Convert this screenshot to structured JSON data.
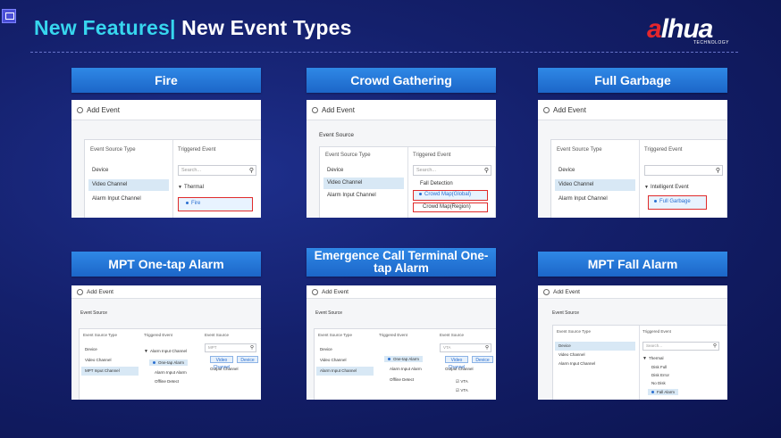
{
  "header": {
    "title_accent": "New Features|",
    "title_rest": " New Event Types",
    "logo_text_a": "a",
    "logo_text_rest": "lhua",
    "logo_sub": "TECHNOLOGY"
  },
  "cards": [
    {
      "title": "Fire",
      "window_title": "Add Event",
      "col1": "Event Source Type",
      "col2": "Triggered Event",
      "rows": [
        "Device",
        "Video Channel",
        "Alarm Input Channel"
      ],
      "search": "Search...",
      "tree_parent": "Thermal",
      "tree_child": "Fire"
    },
    {
      "title": "Crowd Gathering",
      "window_title": "Add Event",
      "section": "Event Source",
      "col1": "Event Source Type",
      "col2": "Triggered Event",
      "rows": [
        "Device",
        "Video Channel",
        "Alarm Input Channel"
      ],
      "search": "Search...",
      "items": [
        "Fall Detection",
        "Crowd Map(Global)",
        "Crowd Map(Region)"
      ]
    },
    {
      "title": "Full Garbage",
      "window_title": "Add Event",
      "col1": "Event Source Type",
      "col2": "Triggered Event",
      "rows": [
        "Device",
        "Video Channel",
        "Alarm Input Channel"
      ],
      "search": "",
      "tree_parent": "Intelligent Event",
      "tree_child": "Full Garbage"
    },
    {
      "title": "MPT One-tap Alarm",
      "window_title": "Add Event",
      "section": "Event Source",
      "col1": "Event Source Type",
      "col2": "Triggered Event",
      "col3": "Event Source",
      "rows": [
        "Device",
        "Video Channel",
        "MPT Input Channel"
      ],
      "tree_parent": "Alarm Input Channel",
      "tree_items": [
        "One-tap Alarm",
        "Alarm Input Alarm",
        "Offline Detect"
      ],
      "pills": [
        "Video Channel",
        "Device"
      ],
      "extra": "Output Channel",
      "search": "MPT"
    },
    {
      "title": "Emergence Call Terminal One-tap Alarm",
      "window_title": "Add Event",
      "section": "Event Source",
      "col1": "Event Source Type",
      "col2": "Triggered Event",
      "col3": "Event Source",
      "rows": [
        "Device",
        "Video Channel",
        "Alarm Input Channel"
      ],
      "tree_items": [
        "One-tap Alarm",
        "Alarm Input Alarm",
        "Offline Detect"
      ],
      "pills": [
        "Video Channel",
        "Device"
      ],
      "extra": "Output Channel",
      "search": "VTA",
      "checks": [
        "VTA",
        "VTA"
      ]
    },
    {
      "title": "MPT Fall Alarm",
      "window_title": "Add Event",
      "section": "Event Source",
      "col1": "Event Source Type",
      "col2": "Triggered Event",
      "rows": [
        "Device",
        "Video Channel",
        "Alarm Input Channel"
      ],
      "search": "Search...",
      "tree_parent": "Thermal",
      "tree_items": [
        "Disk Full",
        "Disk Error",
        "No Disk",
        "Fall Alarm"
      ]
    }
  ],
  "colors": {
    "accent": "#37d6ee",
    "card_header": "#2a7ee0",
    "highlight": "#e02b2b"
  }
}
